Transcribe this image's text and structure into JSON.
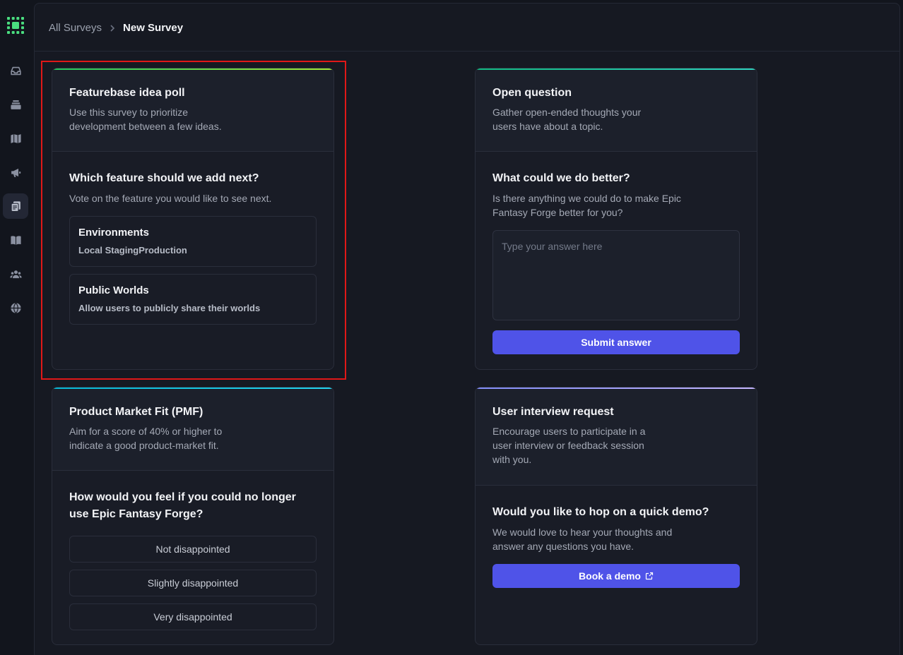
{
  "breadcrumb": {
    "parent": "All Surveys",
    "current": "New Survey"
  },
  "sidebar": {
    "items": [
      {
        "icon": "inbox-icon"
      },
      {
        "icon": "layers-icon"
      },
      {
        "icon": "map-icon"
      },
      {
        "icon": "megaphone-icon"
      },
      {
        "icon": "surveys-icon",
        "active": true
      },
      {
        "icon": "book-icon"
      },
      {
        "icon": "users-icon"
      },
      {
        "icon": "globe-icon"
      }
    ]
  },
  "colors": {
    "accent_green": "#a3e635",
    "accent_teal": "#2dd4bf",
    "accent_cyan": "#22d3ee",
    "accent_purple": "#a78bfa",
    "button": "#4f53e8",
    "highlight": "#e01818"
  },
  "cards": {
    "idea_poll": {
      "title": "Featurebase idea poll",
      "description": "Use this survey to prioritize development between a few ideas.",
      "question": "Which feature should we add next?",
      "subtitle": "Vote on the feature you would like to see next.",
      "options": [
        {
          "title": "Environments",
          "description": "Local StagingProduction"
        },
        {
          "title": "Public Worlds",
          "description": "Allow users to publicly share their worlds"
        }
      ]
    },
    "open_question": {
      "title": "Open question",
      "description": "Gather open-ended thoughts your users have about a topic.",
      "question": "What could we do better?",
      "subtitle": "Is there anything we could do to make Epic Fantasy Forge better for you?",
      "placeholder": "Type your answer here",
      "button": "Submit answer"
    },
    "pmf": {
      "title": "Product Market Fit (PMF)",
      "description": "Aim for a score of 40% or higher to indicate a good product-market fit.",
      "question": "How would you feel if you could no longer use Epic Fantasy Forge?",
      "options": [
        "Not disappointed",
        "Slightly disappointed",
        "Very disappointed"
      ]
    },
    "interview": {
      "title": "User interview request",
      "description": "Encourage users to participate in a user interview or feedback session with you.",
      "question": "Would you like to hop on a quick demo?",
      "subtitle": "We would love to hear your thoughts and answer any questions you have.",
      "button": "Book a demo"
    }
  }
}
